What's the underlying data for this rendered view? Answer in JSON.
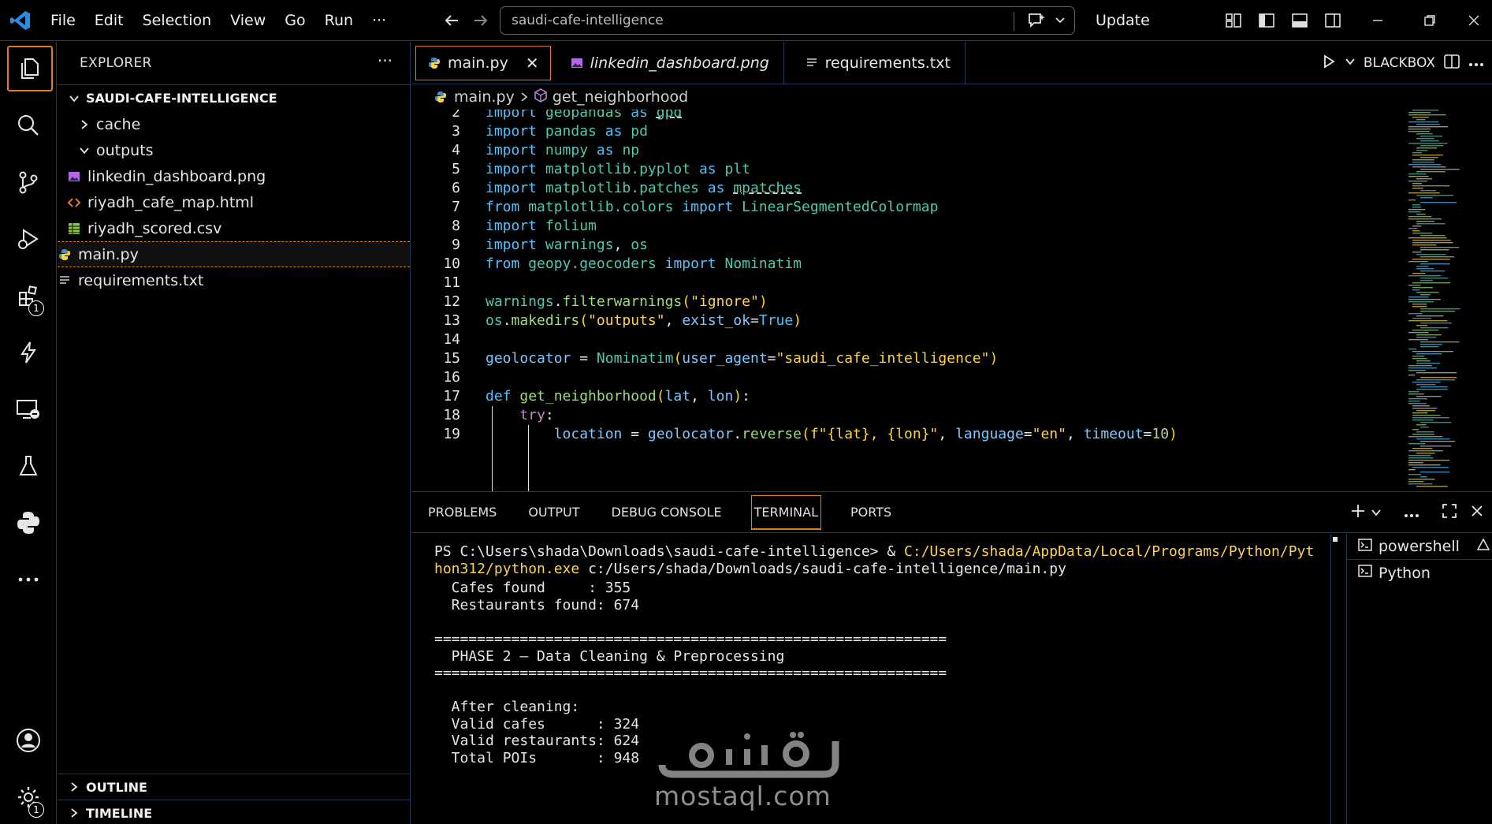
{
  "titlebar": {
    "menu": [
      "File",
      "Edit",
      "Selection",
      "View",
      "Go",
      "Run",
      "···"
    ],
    "search_text": "saudi-cafe-intelligence",
    "update_label": "Update"
  },
  "activity": {
    "extensions_badge": "1",
    "settings_badge": "1"
  },
  "sidebar": {
    "title": "EXPLORER",
    "more": "···",
    "root": "SAUDI-CAFE-INTELLIGENCE",
    "items": [
      {
        "label": "cache",
        "type": "folder",
        "expanded": false
      },
      {
        "label": "outputs",
        "type": "folder",
        "expanded": true
      },
      {
        "label": "linkedin_dashboard.png",
        "type": "image"
      },
      {
        "label": "riyadh_cafe_map.html",
        "type": "html"
      },
      {
        "label": "riyadh_scored.csv",
        "type": "csv"
      },
      {
        "label": "main.py",
        "type": "python"
      },
      {
        "label": "requirements.txt",
        "type": "text"
      }
    ],
    "outline": "OUTLINE",
    "timeline": "TIMELINE"
  },
  "editor": {
    "tabs": [
      {
        "label": "main.py",
        "active": true
      },
      {
        "label": "linkedin_dashboard.png",
        "active": false
      },
      {
        "label": "requirements.txt",
        "active": false
      }
    ],
    "actions_label": "BLACKBOX",
    "breadcrumb": {
      "file": "main.py",
      "symbol": "get_neighborhood"
    },
    "lines": {
      "n2": "2",
      "n3": "3",
      "n4": "4",
      "n5": "5",
      "n6": "6",
      "n7": "7",
      "n8": "8",
      "n9": "9",
      "n10": "10",
      "n11": "11",
      "n12": "12",
      "n13": "13",
      "n14": "14",
      "n15": "15",
      "n16": "16",
      "n17": "17",
      "n18": "18",
      "n19": "19"
    }
  },
  "panel": {
    "tabs": [
      "PROBLEMS",
      "OUTPUT",
      "DEBUG CONSOLE",
      "TERMINAL",
      "PORTS"
    ],
    "active_tab": "TERMINAL",
    "terminal": {
      "prompt1": "PS C:\\Users\\shada\\Downloads\\saudi-cafe-intelligence> & ",
      "python_path1": "C:/Users/shada/AppData/Local/Programs/Python/Pyt",
      "python_path2": "hon312/python.exe",
      "script_path": " c:/Users/shada/Downloads/saudi-cafe-intelligence/main.py",
      "cafes_found": "  Cafes found     : 355",
      "restaurants_found": "  Restaurants found: 674",
      "sep1": "============================================================",
      "phase2": "  PHASE 2 — Data Cleaning & Preprocessing",
      "sep2": "============================================================",
      "after_cleaning": "  After cleaning:",
      "valid_cafes": "  Valid cafes      : 324",
      "valid_restaurants": "  Valid restaurants: 624",
      "total_pois": "  Total POIs       : 948"
    },
    "terminal_list": [
      "powershell",
      "Python"
    ]
  },
  "watermark": {
    "arabic": "مستقل",
    "latin": "mostaql.com"
  },
  "colors": {
    "accent": "#e07b1a",
    "border": "#1e3a5a",
    "keyword": "#4fc1ff",
    "module": "#4ec9b0",
    "function": "#9cdc7a",
    "string": "#ffd24a"
  }
}
